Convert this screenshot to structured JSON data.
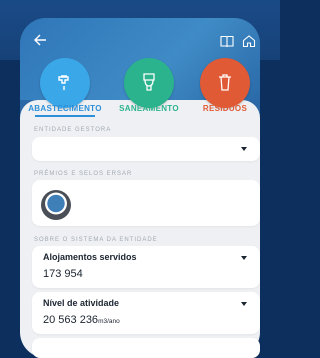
{
  "tabs": [
    {
      "label": "ABASTECIMENTO",
      "color": "#3aa7e8",
      "icon": "faucet-icon",
      "active": true
    },
    {
      "label": "SANEAMENTO",
      "color": "#2bb38d",
      "icon": "toilet-icon",
      "active": false
    },
    {
      "label": "RESÍDUOS",
      "color": "#e05a35",
      "icon": "trash-icon",
      "active": false
    }
  ],
  "sections": {
    "entidade": "ENTIDADE GESTORA",
    "premios": "PRÉMIOS E SELOS ERSAR",
    "sobre": "SOBRE O SISTEMA DA ENTIDADE"
  },
  "cards": {
    "alojamentos": {
      "title": "Alojamentos servidos",
      "value": "173 954"
    },
    "atividade": {
      "title": "Nível de atividade",
      "value": "20 563 236",
      "unit": "m3/ano"
    }
  },
  "colors": {
    "accent": "#2d8fd8",
    "bg": "#0c2f5e"
  }
}
